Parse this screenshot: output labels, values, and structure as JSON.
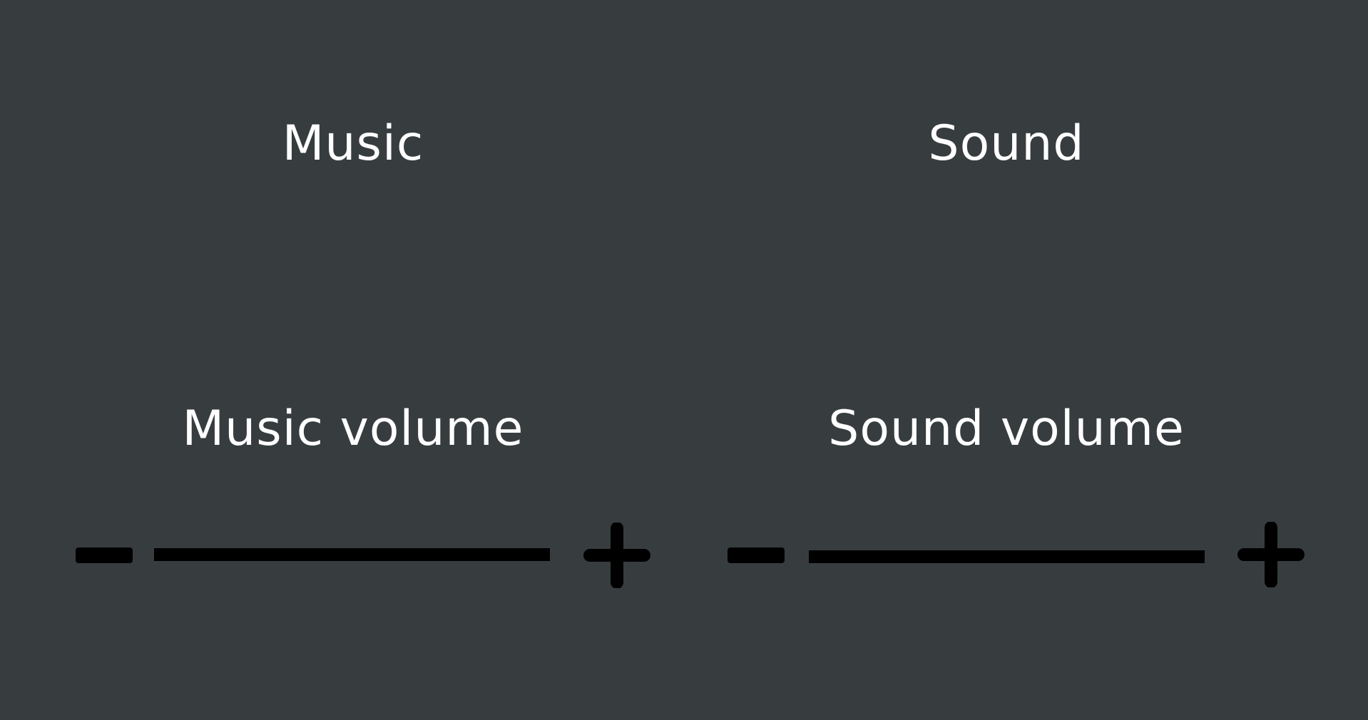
{
  "music": {
    "title": "Music",
    "volume_label": "Music volume"
  },
  "sound": {
    "title": "Sound",
    "volume_label": "Sound volume"
  },
  "icons": {
    "decrease": "minus-icon",
    "increase": "plus-icon"
  },
  "colors": {
    "background": "#373d3f",
    "text": "#ffffff",
    "control": "#000000"
  }
}
